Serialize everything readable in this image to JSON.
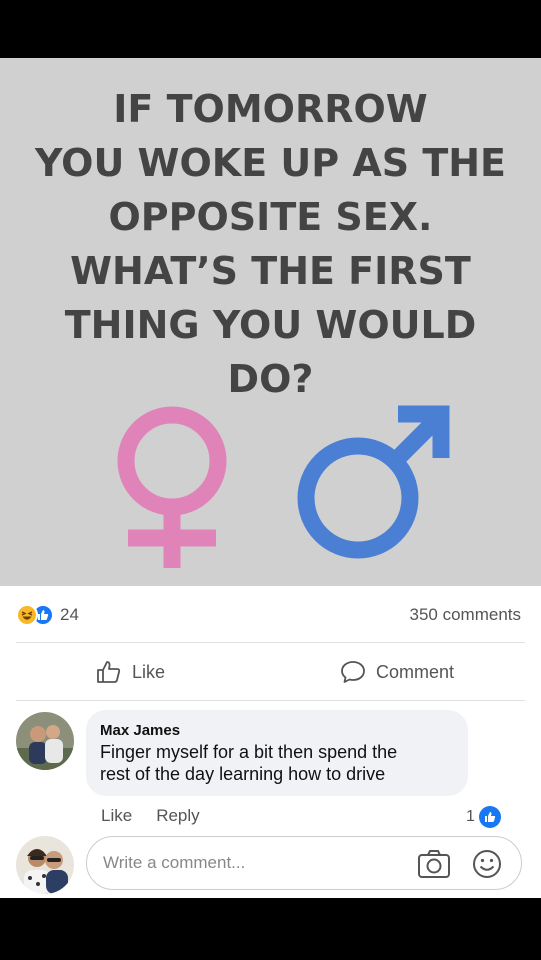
{
  "image": {
    "headline_lines": [
      "IF TOMORROW",
      "YOU WOKE UP AS THE",
      "OPPOSITE SEX.",
      "WHAT’S THE FIRST",
      "THING YOU WOULD",
      "DO?"
    ],
    "symbols": [
      "female-symbol-icon",
      "male-symbol-icon"
    ],
    "colors": {
      "female": "#e083b8",
      "male": "#4a7fd4",
      "background": "#d0d0d0",
      "text": "#444444"
    }
  },
  "post_stats": {
    "reactions": [
      "haha-reaction-icon",
      "like-reaction-icon"
    ],
    "reaction_count": "24",
    "comments_count": "350 comments"
  },
  "actions": {
    "like_label": "Like",
    "comment_label": "Comment"
  },
  "comment": {
    "author": "Max James",
    "text_lines": [
      "Finger myself for a bit then spend the",
      "rest of the day learning how to drive"
    ],
    "like_label": "Like",
    "reply_label": "Reply",
    "like_count": "1"
  },
  "composer": {
    "placeholder": "Write a comment...",
    "icons": [
      "camera-icon",
      "smiley-icon"
    ]
  },
  "theme": {
    "facebook_blue": "#1877f2",
    "muted_text": "#555555"
  }
}
